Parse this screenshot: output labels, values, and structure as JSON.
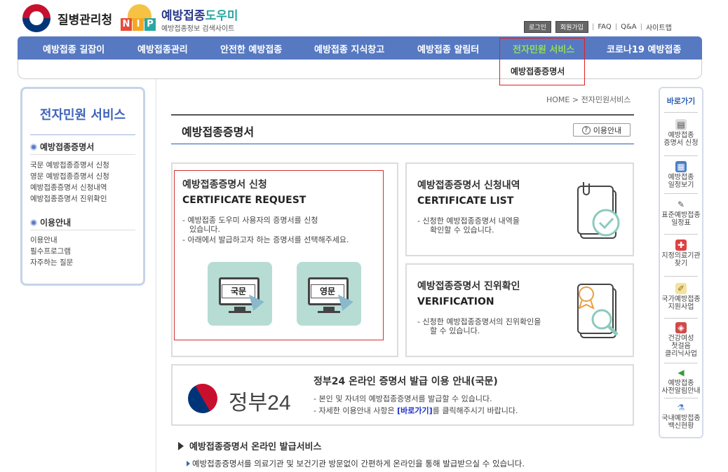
{
  "header": {
    "agency": "질병관리청",
    "nip_letters": [
      "N",
      "I",
      "P"
    ],
    "site_title_1": "예방접종",
    "site_title_2": "도우미",
    "site_sub": "예방접종정보 검색사이트",
    "login": "로그인",
    "join": "회원가입",
    "faq": "FAQ",
    "qna": "Q&A",
    "sitemap": "사이트맵"
  },
  "gnb": [
    "예방접종 길잡이",
    "예방접종관리",
    "안전한 예방접종",
    "예방접종 지식창고",
    "예방접종 알림터",
    "전자민원 서비스",
    "코로나19 예방접종"
  ],
  "gnb_sub": "예방접종증명서",
  "sidebar": {
    "title": "전자민원 서비스",
    "sec1": "예방접종증명서",
    "sec1_links": [
      "국문 예방접종증명서 신청",
      "영문 예방접종증명서 신청",
      "예방접종증명서 신청내역",
      "예방접종증명서 진위확인"
    ],
    "sec2": "이용안내",
    "sec2_links": [
      "이용안내",
      "필수프로그램",
      "자주하는 질문"
    ]
  },
  "breadcrumb": "HOME > 전자민원서비스",
  "page_title": "예방접종증명서",
  "guide_button": "이용안내",
  "card_request": {
    "title_ko": "예방접종증명서 신청",
    "title_en": "CERTIFICATE REQUEST",
    "desc1": "- 예방접종 도우미 사용자의 증명서를 신청",
    "desc1b": "있습니다.",
    "desc2": "- 아래에서 발급하고자 하는 증명서를 선택해주세요.",
    "btn_ko": "국문",
    "btn_en": "영문"
  },
  "card_list": {
    "title_ko": "예방접종증명서 신청내역",
    "title_en": "CERTIFICATE LIST",
    "desc1": "- 신청한 예방접종증명서 내역을",
    "desc1b": "확인할 수 있습니다."
  },
  "card_verify": {
    "title_ko": "예방접종증명서 진위확인",
    "title_en": "VERIFICATION",
    "desc1": "- 신청한 예방접종증명서의 진위확인을",
    "desc1b": "할 수 있습니다."
  },
  "gov24": {
    "logo_text": "정부24",
    "title": "정부24 온라인 증명서 발급 이용 안내(국문)",
    "desc1": "- 본인 및 자녀의 예방접종증명서를 발급할 수 있습니다.",
    "desc2_pre": "- 자세한 이용안내 사항은 ",
    "desc2_link": "[바로가기]",
    "desc2_post": "를 클릭해주시기 바랍니다."
  },
  "quick": {
    "title": "바로가기",
    "items": [
      {
        "line1": "예방접종",
        "line2": "증명서 신청",
        "icon": "printer-icon"
      },
      {
        "line1": "예방접종",
        "line2": "일정보기",
        "icon": "calendar-icon"
      },
      {
        "line1": "표준예방접종",
        "line2": "일정표",
        "icon": "syringe-icon"
      },
      {
        "line1": "지정의료기관",
        "line2": "찾기",
        "icon": "hospital-icon"
      },
      {
        "line1": "국가예방접종",
        "line2": "지원사업",
        "icon": "document-icon"
      },
      {
        "line1": "건강여성",
        "line2": "첫걸음",
        "line3": "클리닉사업",
        "icon": "box-icon"
      },
      {
        "line1": "예방접종",
        "line2": "사전알림안내",
        "icon": "speaker-icon"
      },
      {
        "line1": "국내예방접종",
        "line2": "백신현황",
        "icon": "vaccine-icon"
      }
    ]
  },
  "bottom": {
    "title": "예방접종증명서 온라인 발급서비스",
    "desc": "예방접종증명서를 의료기관 및 보건기관 방문없이 간편하게 온라인을 통해 발급받으실 수 있습니다."
  },
  "colors": {
    "gnb": "#5779c2",
    "gnb_selected": "#8ee05a",
    "highlight_frame": "#e02020",
    "mint": "#b7dcd4"
  }
}
